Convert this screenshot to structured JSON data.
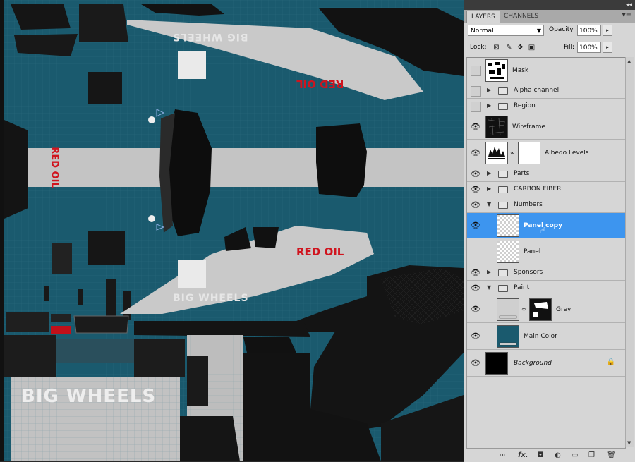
{
  "panel": {
    "tabs": [
      {
        "label": "LAYERS"
      },
      {
        "label": "CHANNELS"
      }
    ],
    "blend_mode": "Normal",
    "opacity_label": "Opacity:",
    "opacity_value": "100%",
    "lock_label": "Lock:",
    "fill_label": "Fill:",
    "fill_value": "100%"
  },
  "layers": [
    {
      "name": "Mask",
      "visible": false,
      "kind": "layer"
    },
    {
      "name": "Alpha channel",
      "visible": false,
      "kind": "group",
      "expanded": false
    },
    {
      "name": "Region",
      "visible": false,
      "kind": "group",
      "expanded": false
    },
    {
      "name": "Wireframe",
      "visible": true,
      "kind": "layer"
    },
    {
      "name": "Albedo Levels",
      "visible": true,
      "kind": "adjustment"
    },
    {
      "name": "Parts",
      "visible": true,
      "kind": "group",
      "expanded": false
    },
    {
      "name": "CARBON FIBER",
      "visible": true,
      "kind": "group",
      "expanded": false
    },
    {
      "name": "Numbers",
      "visible": true,
      "kind": "group",
      "expanded": true
    },
    {
      "name": "Panel copy",
      "visible": true,
      "kind": "layer",
      "selected": true
    },
    {
      "name": "Panel",
      "visible": true,
      "kind": "layer"
    },
    {
      "name": "Sponsors",
      "visible": true,
      "kind": "group",
      "expanded": false
    },
    {
      "name": "Paint",
      "visible": true,
      "kind": "group",
      "expanded": true
    },
    {
      "name": "Grey",
      "visible": true,
      "kind": "layer_mask"
    },
    {
      "name": "Main Color",
      "visible": true,
      "kind": "layer"
    },
    {
      "name": "Background",
      "visible": true,
      "kind": "background",
      "locked": true
    }
  ],
  "canvas": {
    "texts": {
      "top_big_wheels": "BIG WHEELS",
      "red_oil_top": "RED OIL",
      "red_oil_side": "RED OIL",
      "red_oil_mid": "RED OIL",
      "mid_big_wheels": "BIG WHEELS",
      "bottom_big_wheels": "BIG WHEELS"
    }
  },
  "colors": {
    "main_color": "#1a5a6e",
    "selection": "#3d95ef",
    "sponsor_red": "#d0141e",
    "panel_grey": "#cfcfcf"
  },
  "icons": {
    "visibility": "eye-icon",
    "group": "folder-icon",
    "bottom_bar": [
      "link-icon",
      "fx-icon",
      "add-mask-icon",
      "adjustment-icon",
      "new-group-icon",
      "new-layer-icon",
      "trash-icon"
    ]
  }
}
